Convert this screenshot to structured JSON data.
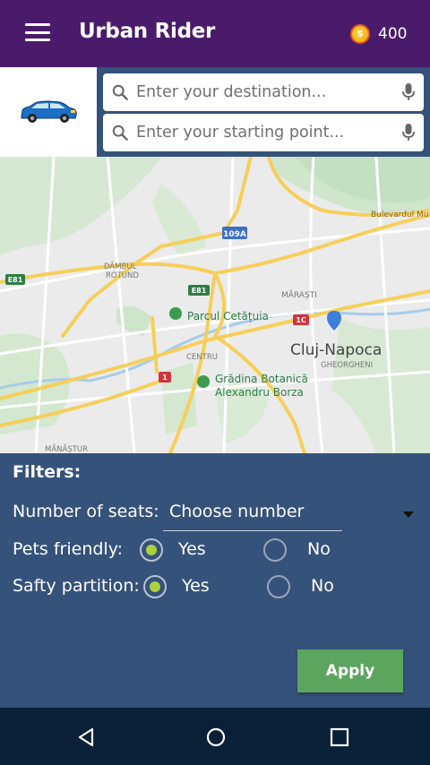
{
  "app_bar": {
    "title": "Urban Rider",
    "coins": "400",
    "coin_symbol": "$",
    "menu_icon": "hamburger-menu-icon",
    "coin_icon": "coin-icon"
  },
  "search": {
    "destination_placeholder": "Enter your destination...",
    "start_placeholder": "Enter your starting point...",
    "search_icon": "search-icon",
    "mic_icon": "microphone-icon",
    "vehicle_icon": "car-icon"
  },
  "map": {
    "labels": {
      "road_109a": "109A",
      "e81_west": "E81",
      "e81_center": "E81",
      "road_1c": "1C",
      "road_1": "1",
      "bulevardul": "Bulevardul Mu",
      "dambul": "DÂMBUL",
      "rotund": "ROTUND",
      "marasti": "MĂRAȘTI",
      "parc": "Parcul Cetățuia",
      "city": "Cluj-Napoca",
      "gheorgheni": "GHEORGHENI",
      "centru": "CENTRU",
      "gradina1": "Grădina Botanică",
      "gradina2": "Alexandru Borza",
      "manastur": "MĂNĂȘTUR"
    }
  },
  "filters": {
    "title": "Filters:",
    "seats_label": "Number of seats:",
    "seats_value": "Choose number",
    "pets_label": "Pets friendly:",
    "partition_label": "Safty partition:",
    "yes_label": "Yes",
    "no_label": "No",
    "pets_selected": "Yes",
    "partition_selected": "Yes",
    "apply_label": "Apply"
  },
  "colors": {
    "app_bar": "#4a1b6a",
    "panel": "#35527a",
    "accent_green": "#a9d23d",
    "apply_button": "#5ba55f",
    "nav_bar": "#0a2037"
  }
}
